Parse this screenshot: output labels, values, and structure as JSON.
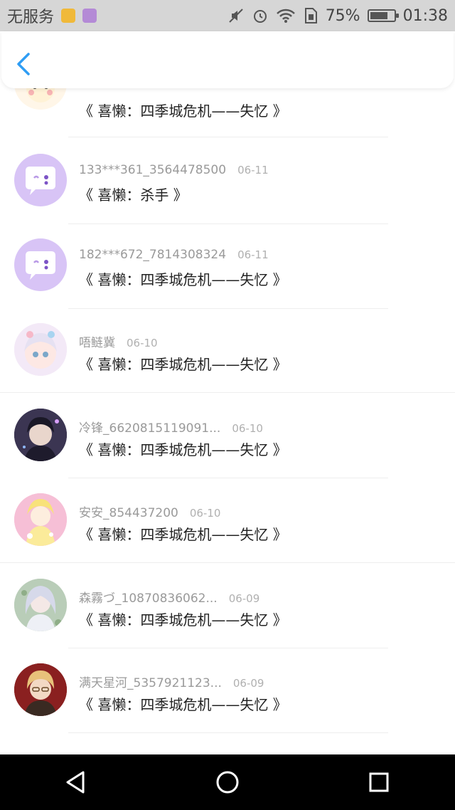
{
  "status_bar": {
    "carrier": "无服务",
    "battery_percent": "75%",
    "battery_level": 0.75,
    "time": "01:38",
    "icons": [
      "sim-yellow-icon",
      "gallery-purple-icon",
      "mute-icon",
      "alarm-icon",
      "wifi-icon",
      "sim-icon",
      "battery-icon"
    ]
  },
  "header": {
    "back_icon": "chevron-left-icon",
    "accent_color": "#2f9df4"
  },
  "items": [
    {
      "user": "",
      "date": "",
      "title": "《 喜懒：四季城危机——失忆 》",
      "avatar": "sheep-avatar"
    },
    {
      "user": "133***361_3564478500",
      "date": "06-11",
      "title": "《 喜懒：杀手 》",
      "avatar": "chat-bubble-avatar"
    },
    {
      "user": "182***672_7814308324",
      "date": "06-11",
      "title": "《 喜懒：四季城危机——失忆 》",
      "avatar": "chat-bubble-avatar"
    },
    {
      "user": "唔鲢冀",
      "date": "06-10",
      "title": "《 喜懒：四季城危机——失忆 》",
      "avatar": "anime-avatar-pastel"
    },
    {
      "user": "冷锋_6620815119091...",
      "date": "06-10",
      "title": "《 喜懒：四季城危机——失忆 》",
      "avatar": "anime-avatar-dark"
    },
    {
      "user": "安安_854437200",
      "date": "06-10",
      "title": "《 喜懒：四季城危机——失忆 》",
      "avatar": "anime-avatar-yellow"
    },
    {
      "user": "森霧づ_10870836062...",
      "date": "06-09",
      "title": "《 喜懒：四季城危机——失忆 》",
      "avatar": "anime-avatar-silver"
    },
    {
      "user": "满天星河_5357921123...",
      "date": "06-09",
      "title": "《 喜懒：四季城危机——失忆 》",
      "avatar": "anime-avatar-red"
    }
  ],
  "nav": {
    "back": "triangle-back-icon",
    "home": "circle-home-icon",
    "recent": "square-recent-icon"
  }
}
